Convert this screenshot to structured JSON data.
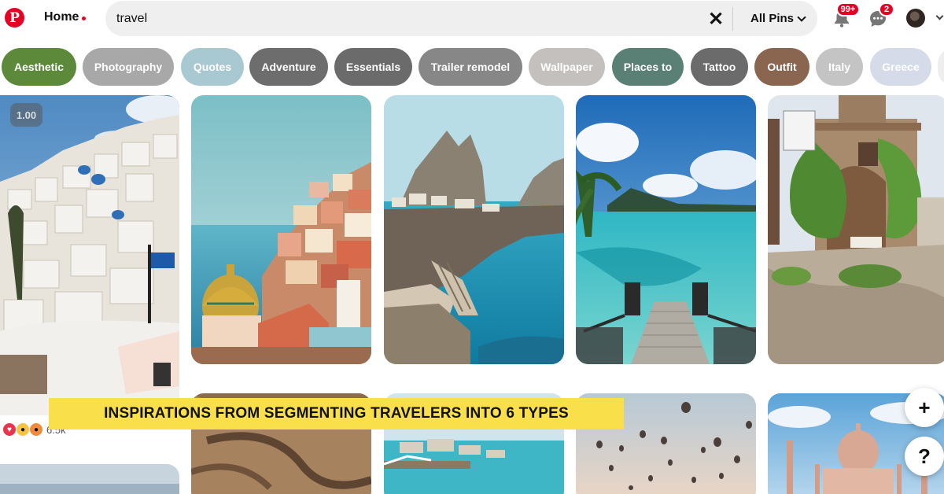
{
  "header": {
    "logo_letter": "P",
    "home_label": "Home",
    "search": {
      "value": "travel"
    },
    "filter_label": "All Pins",
    "notifications_badge": "99+",
    "messages_badge": "2"
  },
  "pills": [
    {
      "label": "Aesthetic",
      "color": "#5c8a3a"
    },
    {
      "label": "Photography",
      "color": "#a8a8a8"
    },
    {
      "label": "Quotes",
      "color": "#a9c9d2"
    },
    {
      "label": "Adventure",
      "color": "#6d6d6d"
    },
    {
      "label": "Essentials",
      "color": "#6b6b6b"
    },
    {
      "label": "Trailer remodel",
      "color": "#878787"
    },
    {
      "label": "Wallpaper",
      "color": "#c4c0bd"
    },
    {
      "label": "Places to",
      "color": "#5a8075"
    },
    {
      "label": "Tattoo",
      "color": "#6b6b6b"
    },
    {
      "label": "Outfit",
      "color": "#8a6650"
    },
    {
      "label": "Italy",
      "color": "#c4c4c4"
    },
    {
      "label": "Greece",
      "color": "#d5dbe9"
    }
  ],
  "pin_overlay": {
    "duration_badge": "1.00",
    "reaction_count": "6.5k"
  },
  "caption": "INSPIRATIONS FROM SEGMENTING TRAVELERS INTO 6 TYPES",
  "fab": {
    "add": "+",
    "help": "?"
  }
}
